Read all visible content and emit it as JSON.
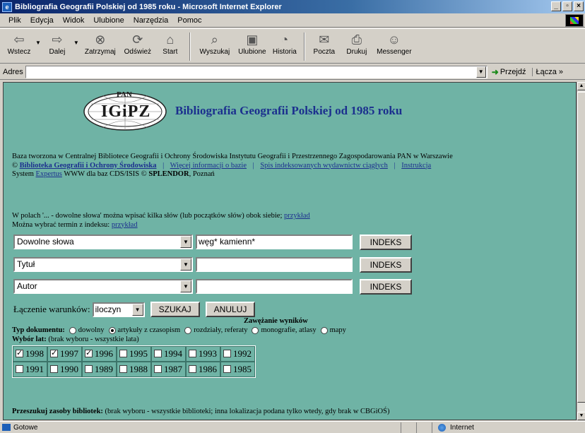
{
  "window": {
    "title": "Bibliografia Geografii Polskiej od 1985 roku - Microsoft Internet Explorer"
  },
  "menu": [
    "Plik",
    "Edycja",
    "Widok",
    "Ulubione",
    "Narzędzia",
    "Pomoc"
  ],
  "toolbar": {
    "back": "Wstecz",
    "forward": "Dalej",
    "stop": "Zatrzymaj",
    "refresh": "Odśwież",
    "home": "Start",
    "search": "Wyszukaj",
    "favorites": "Ulubione",
    "history": "Historia",
    "mail": "Poczta",
    "print": "Drukuj",
    "messenger": "Messenger"
  },
  "address": {
    "label": "Adres",
    "value": "",
    "go": "Przejdź",
    "links": "Łącza »"
  },
  "page": {
    "logo_top": "PAN",
    "logo_main": "IGiPZ",
    "title": "Bibliografia Geografii Polskiej od 1985 roku",
    "desc_line1": "Baza tworzona w Centralnej Bibliotece Geografii i Ochrony Środowiska Instytutu Geografii i Przestrzennego Zagospodarowania PAN w Warszawie",
    "copyright": "©",
    "link_library": "Biblioteka Geografii i Ochrony Środowiska",
    "link_more": "Więcej informacji o bazie",
    "link_serials": "Spis indeksowanych wydawnictw ciągłych",
    "link_instructions": "Instrukcja",
    "system_prefix": "System",
    "system_link": "Expertus",
    "system_mid": "WWW dla baz CDS/ISIS ©",
    "system_company": "SPLENDOR",
    "system_city": ", Poznań",
    "hint1_text": "W polach '... - dowolne słowa' można wpisać kilka słów (lub początków słów) obok siebie;",
    "hint1_link": "przykład",
    "hint2_text": "Można wybrać termin z indeksu:",
    "hint2_link": "przykład"
  },
  "search_rows": [
    {
      "field": "Dowolne słowa",
      "value": "węg* kamienn*",
      "button": "INDEKS"
    },
    {
      "field": "Tytuł",
      "value": "",
      "button": "INDEKS"
    },
    {
      "field": "Autor",
      "value": "",
      "button": "INDEKS"
    }
  ],
  "combine": {
    "label": "Łączenie warunków:",
    "value": "iloczyn",
    "search_button": "SZUKAJ",
    "cancel_button": "ANULUJ"
  },
  "narrowing": {
    "title": "Zawężanie wyników",
    "doctype_label": "Typ dokumentu:",
    "doctypes": [
      {
        "label": "dowolny",
        "selected": false
      },
      {
        "label": "artykuły z czasopism",
        "selected": true
      },
      {
        "label": "rozdziały, referaty",
        "selected": false
      },
      {
        "label": "monografie, atlasy",
        "selected": false
      },
      {
        "label": "mapy",
        "selected": false
      }
    ],
    "years_label": "Wybór lat:",
    "years_note": "(brak wyboru - wszystkie lata)",
    "years_row1": [
      {
        "year": "1998",
        "checked": true
      },
      {
        "year": "1997",
        "checked": true
      },
      {
        "year": "1996",
        "checked": true
      },
      {
        "year": "1995",
        "checked": false
      },
      {
        "year": "1994",
        "checked": false
      },
      {
        "year": "1993",
        "checked": false
      },
      {
        "year": "1992",
        "checked": false
      }
    ],
    "years_row2": [
      {
        "year": "1991",
        "checked": false
      },
      {
        "year": "1990",
        "checked": false
      },
      {
        "year": "1989",
        "checked": false
      },
      {
        "year": "1988",
        "checked": false
      },
      {
        "year": "1987",
        "checked": false
      },
      {
        "year": "1986",
        "checked": false
      },
      {
        "year": "1985",
        "checked": false
      }
    ]
  },
  "libraries": {
    "label": "Przeszukuj zasoby bibliotek:",
    "note": "(brak wyboru - wszystkie biblioteki; inna lokalizacja podana tylko wtedy, gdy brak w CBGiOŚ)"
  },
  "status": {
    "text": "Gotowe",
    "zone": "Internet"
  },
  "colors": {
    "page_bg": "#6fb3a5",
    "link": "#1b2f8e",
    "title": "#1b2f8e"
  }
}
